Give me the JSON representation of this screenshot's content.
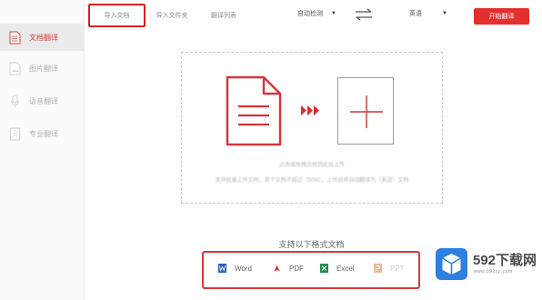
{
  "sidebar": {
    "items": [
      {
        "label": "文档翻译",
        "icon": "document-icon"
      },
      {
        "label": "图片翻译",
        "icon": "image-icon"
      },
      {
        "label": "语音翻译",
        "icon": "microphone-icon"
      },
      {
        "label": "专业翻译",
        "icon": "book-icon"
      }
    ]
  },
  "topbar": {
    "tabs": [
      {
        "label": "导入文档"
      },
      {
        "label": "导入文件夹"
      },
      {
        "label": "翻译列表"
      }
    ],
    "source_lang": "自动检测",
    "target_lang": "英语",
    "swap_icon": "swap-arrows-icon",
    "start_button": "开始翻译"
  },
  "upload": {
    "hint_line1": "点击或拖拽文档到此处上传",
    "hint_line2": "支持批量上传文档，单个文档不超过（50M），上传后将自动翻译为（英语）文档"
  },
  "formats": {
    "title": "支持以下格式文档",
    "items": [
      {
        "label": "Word",
        "icon": "word-icon",
        "color": "#2b5fc7"
      },
      {
        "label": "PDF",
        "icon": "pdf-icon",
        "color": "#d62b2b"
      },
      {
        "label": "Excel",
        "icon": "excel-icon",
        "color": "#1e8a4c"
      },
      {
        "label": "PPT",
        "icon": "ppt-icon",
        "color": "#e3672b"
      }
    ]
  },
  "watermark": {
    "brand": "592下载网",
    "url": "www.592xz.com"
  },
  "colors": {
    "accent": "#e42f2f",
    "highlight_border": "#d42424"
  }
}
